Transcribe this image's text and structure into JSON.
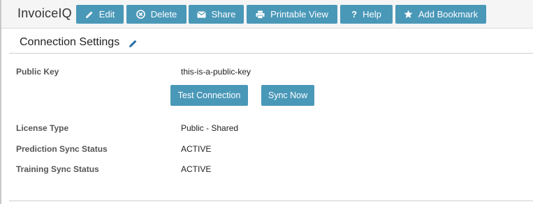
{
  "app": {
    "title": "InvoiceIQ"
  },
  "toolbar": {
    "buttons": [
      {
        "label": "Edit",
        "icon": "pencil-icon"
      },
      {
        "label": "Delete",
        "icon": "delete-circle-icon"
      },
      {
        "label": "Share",
        "icon": "envelope-icon"
      },
      {
        "label": "Printable View",
        "icon": "printer-icon"
      },
      {
        "label": "Help",
        "icon": "question-icon"
      },
      {
        "label": "Add Bookmark",
        "icon": "star-icon"
      }
    ]
  },
  "section": {
    "title": "Connection Settings",
    "edit_icon": "pencil-icon"
  },
  "fields": {
    "public_key": {
      "label": "Public Key",
      "value": "this-is-a-public-key"
    },
    "license_type": {
      "label": "License Type",
      "value": "Public - Shared"
    },
    "prediction_sync": {
      "label": "Prediction Sync Status",
      "value": "ACTIVE"
    },
    "training_sync": {
      "label": "Training Sync Status",
      "value": "ACTIVE"
    }
  },
  "actions": {
    "test_connection": "Test Connection",
    "sync_now": "Sync Now"
  },
  "colors": {
    "button_bg": "#4a98b8",
    "button_text": "#ffffff",
    "toolbar_bg": "#f5f5f5",
    "pencil_accent": "#2a6fa8"
  }
}
